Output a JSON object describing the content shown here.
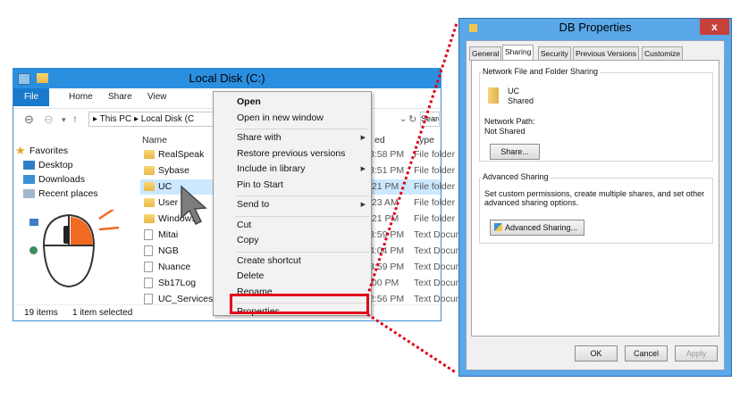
{
  "explorer": {
    "title": "Local Disk (C:)",
    "ribbon_tabs": [
      "File",
      "Home",
      "Share",
      "View"
    ],
    "address": "▸ This PC ▸ Local Disk (C",
    "search_placeholder": "Search",
    "nav": {
      "favorites": "Favorites",
      "items": [
        "Desktop",
        "Downloads",
        "Recent places"
      ]
    },
    "columns": {
      "name": "Name",
      "date": "ed",
      "type": "ype"
    },
    "files": [
      {
        "name": "RealSpeak",
        "date": "3:58 PM",
        "type": "File folder",
        "icon": "folder"
      },
      {
        "name": "Sybase",
        "date": "3:51 PM",
        "type": "File folder",
        "icon": "folder"
      },
      {
        "name": "UC",
        "date": ":21 PM",
        "type": "File folder",
        "icon": "folder",
        "selected": true
      },
      {
        "name": "User",
        "date": ":23 AM",
        "type": "File folder",
        "icon": "folder"
      },
      {
        "name": "Windows",
        "date": ":21 PM",
        "type": "File folder",
        "icon": "folder"
      },
      {
        "name": "Mitai",
        "date": "3:59 PM",
        "type": "Text Docum",
        "icon": "doc"
      },
      {
        "name": "NGB",
        "date": "4:04 PM",
        "type": "Text Docum",
        "icon": "doc"
      },
      {
        "name": "Nuance",
        "date": "3:59 PM",
        "type": "Text Docum",
        "icon": "doc"
      },
      {
        "name": "Sb17Log",
        "date": ":00 PM",
        "type": "Text Docum",
        "icon": "doc"
      },
      {
        "name": "UC_Services",
        "date": "2:56 PM",
        "type": "Text Docum",
        "icon": "doc"
      }
    ],
    "status": {
      "count": "19 items",
      "selection": "1 item selected"
    }
  },
  "context_menu": {
    "groups": [
      [
        {
          "label": "Open",
          "bold": true
        },
        {
          "label": "Open in new window"
        }
      ],
      [
        {
          "label": "Share with",
          "submenu": true
        },
        {
          "label": "Restore previous versions"
        },
        {
          "label": "Include in library",
          "submenu": true
        },
        {
          "label": "Pin to Start"
        }
      ],
      [
        {
          "label": "Send to",
          "submenu": true
        }
      ],
      [
        {
          "label": "Cut"
        },
        {
          "label": "Copy"
        }
      ],
      [
        {
          "label": "Create shortcut"
        },
        {
          "label": "Delete"
        },
        {
          "label": "Rename"
        }
      ],
      [
        {
          "label": "Properties"
        }
      ]
    ]
  },
  "dialog": {
    "title": "DB Properties",
    "close": "x",
    "tabs": [
      "General",
      "Sharing",
      "Security",
      "Previous Versions",
      "Customize"
    ],
    "active_tab": "Sharing",
    "network_sharing": {
      "group_title": "Network File and Folder Sharing",
      "folder_name": "UC",
      "folder_state": "Shared",
      "path_label": "Network Path:",
      "path_value": "Not Shared",
      "share_button": "Share..."
    },
    "advanced_sharing": {
      "group_title": "Advanced Sharing",
      "description_line1": "Set custom permissions, create multiple shares, and set other",
      "description_line2": "advanced sharing options.",
      "button": "Advanced Sharing..."
    },
    "buttons": {
      "ok": "OK",
      "cancel": "Cancel",
      "apply": "Apply"
    }
  },
  "colors": {
    "accent": "#2b8fe0",
    "highlight": "#e2001a",
    "selection": "#cce8ff",
    "dialog_frame": "#5aa8e8"
  }
}
